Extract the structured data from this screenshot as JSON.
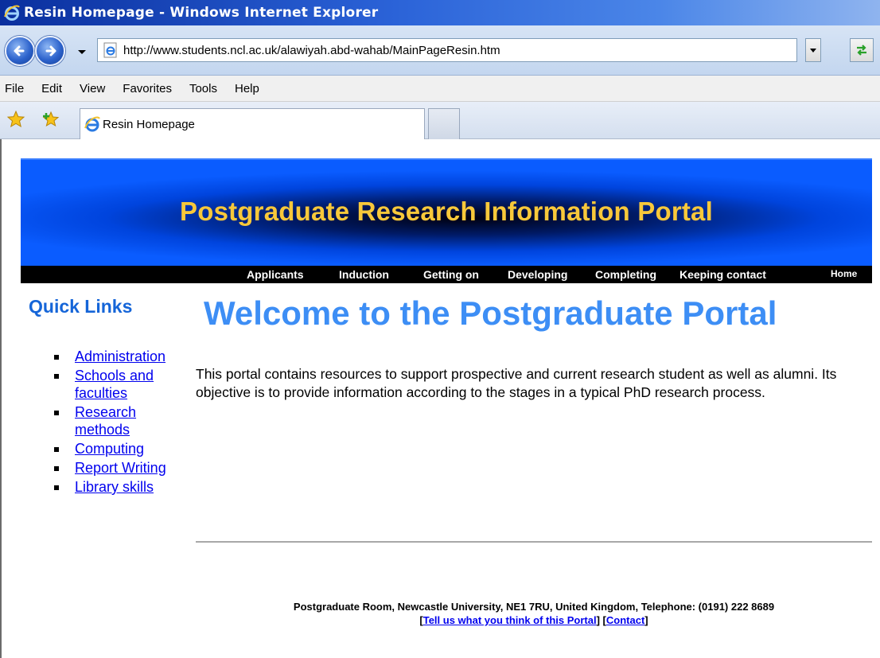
{
  "window": {
    "title": "Resin Homepage - Windows Internet Explorer"
  },
  "address_bar": {
    "url": "http://www.students.ncl.ac.uk/alawiyah.abd-wahab/MainPageResin.htm"
  },
  "menu": {
    "items": [
      "File",
      "Edit",
      "View",
      "Favorites",
      "Tools",
      "Help"
    ]
  },
  "tab": {
    "title": "Resin Homepage"
  },
  "banner": {
    "title": "Postgraduate Research Information Portal"
  },
  "nav": {
    "items": [
      "Applicants",
      "Induction",
      "Getting on",
      "Developing",
      "Completing",
      "Keeping contact",
      "Home"
    ]
  },
  "quick_links": {
    "title": "Quick Links",
    "items": [
      "Administration",
      "Schools and faculties",
      "Research methods",
      "Computing",
      "Report Writing",
      "Library skills"
    ]
  },
  "main": {
    "heading": "Welcome to the Postgraduate Portal",
    "intro": "This portal contains resources to support prospective and current research student as well as alumni. Its objective is to provide information according to the stages in a typical PhD research process."
  },
  "footer": {
    "address": "Postgraduate Room, Newcastle University, NE1 7RU, United Kingdom, Telephone: (0191) 222 8689",
    "feedback_link": "Tell us what you think of this Portal",
    "contact_link": "Contact"
  },
  "colors": {
    "banner_text": "#f8c83a",
    "heading": "#3d8ef5",
    "quick_links_title": "#1565d8",
    "link": "#0000ee"
  }
}
